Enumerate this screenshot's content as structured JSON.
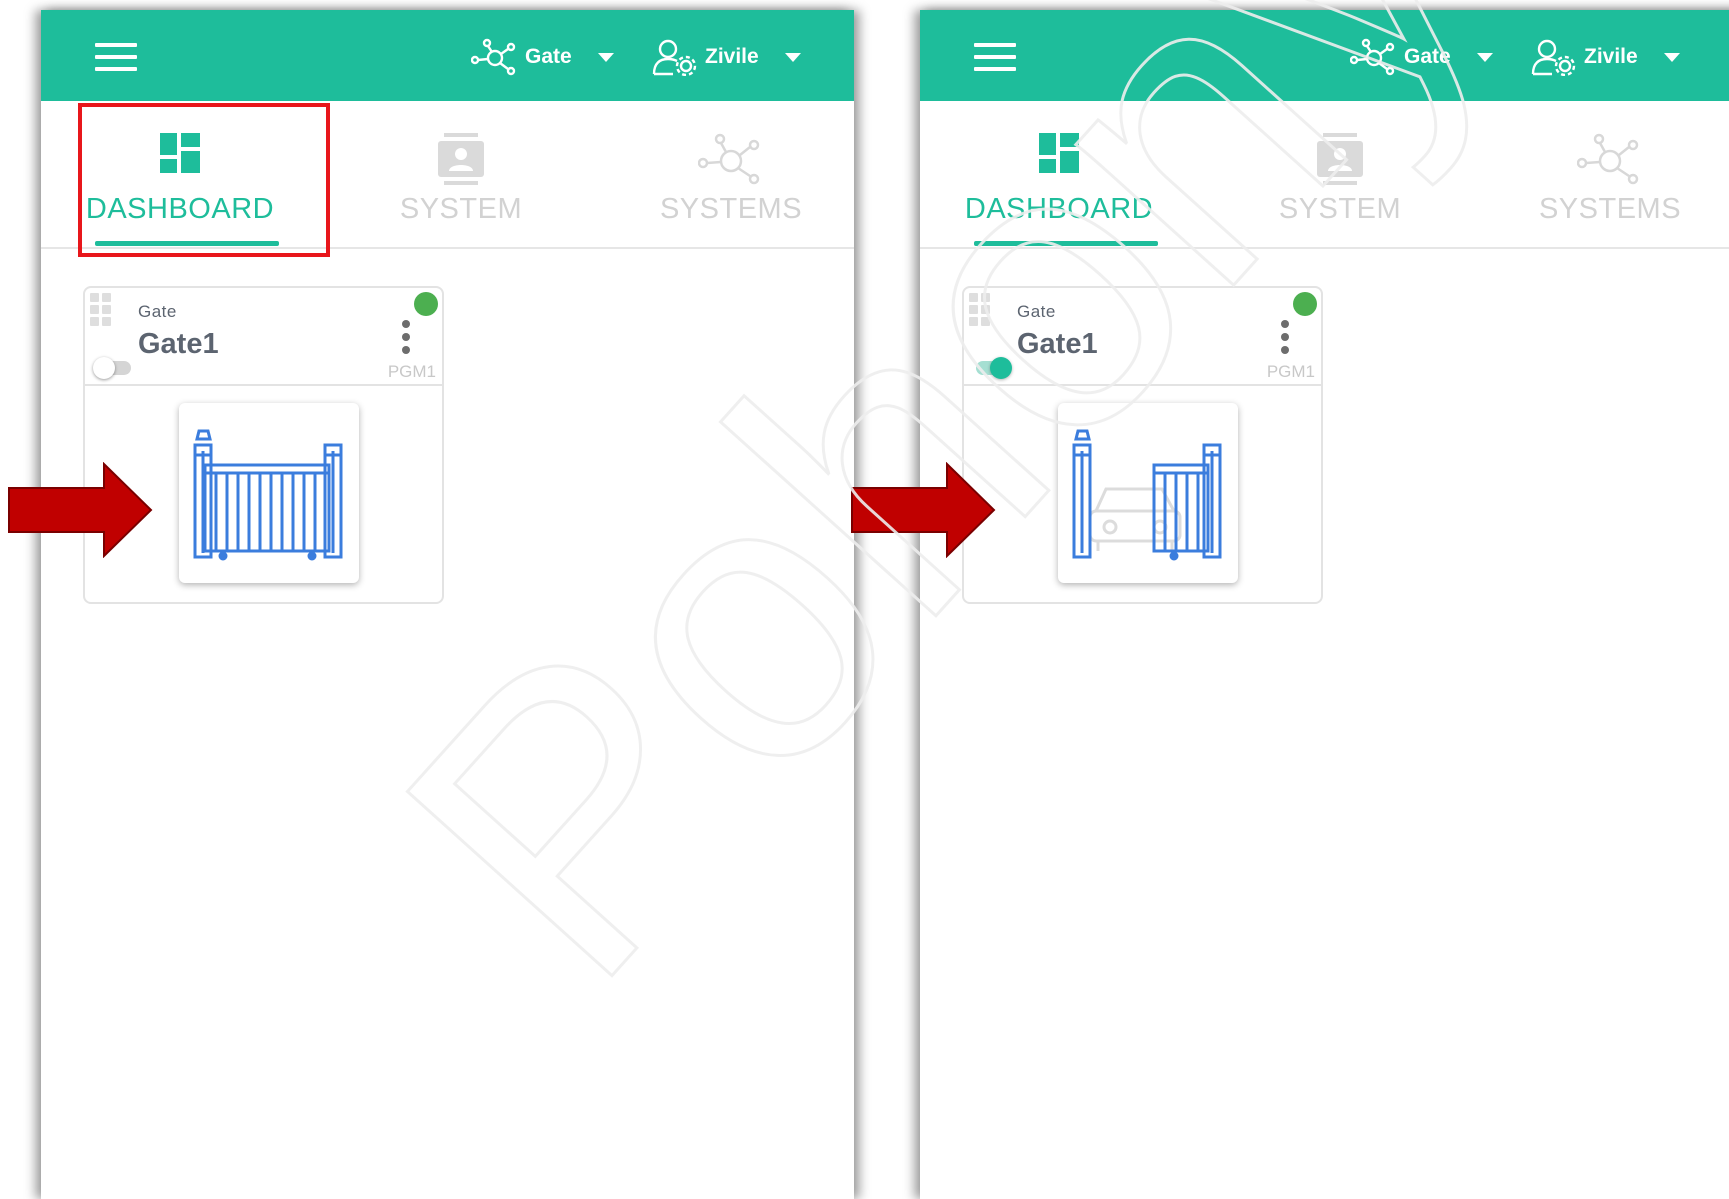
{
  "colors": {
    "accent": "#1ebd9b",
    "status_online": "#4caf50",
    "gate_icon": "#3b7ddd",
    "arrow": "#c00000",
    "highlight": "#e8161b"
  },
  "screens": [
    {
      "header": {
        "system_menu": {
          "icon": "network-icon",
          "label": "Gate"
        },
        "user_menu": {
          "icon": "user-settings-icon",
          "label": "Zivile"
        }
      },
      "tabs": [
        {
          "label": "DASHBOARD",
          "icon": "dashboard-icon",
          "active": true
        },
        {
          "label": "SYSTEM",
          "icon": "contact-card-icon",
          "active": false
        },
        {
          "label": "SYSTEMS",
          "icon": "network-icon",
          "active": false
        }
      ],
      "card": {
        "type": "Gate",
        "name": "Gate1",
        "output": "PGM1",
        "status": "online",
        "toggle_on": false,
        "gate_state": "closed"
      }
    },
    {
      "header": {
        "system_menu": {
          "icon": "network-icon",
          "label": "Gate"
        },
        "user_menu": {
          "icon": "user-settings-icon",
          "label": "Zivile"
        }
      },
      "tabs": [
        {
          "label": "DASHBOARD",
          "icon": "dashboard-icon",
          "active": true
        },
        {
          "label": "SYSTEM",
          "icon": "contact-card-icon",
          "active": false
        },
        {
          "label": "SYSTEMS",
          "icon": "network-icon",
          "active": false
        }
      ],
      "card": {
        "type": "Gate",
        "name": "Gate1",
        "output": "PGM1",
        "status": "online",
        "toggle_on": true,
        "gate_state": "open"
      }
    }
  ],
  "watermark": "Pohony Li"
}
